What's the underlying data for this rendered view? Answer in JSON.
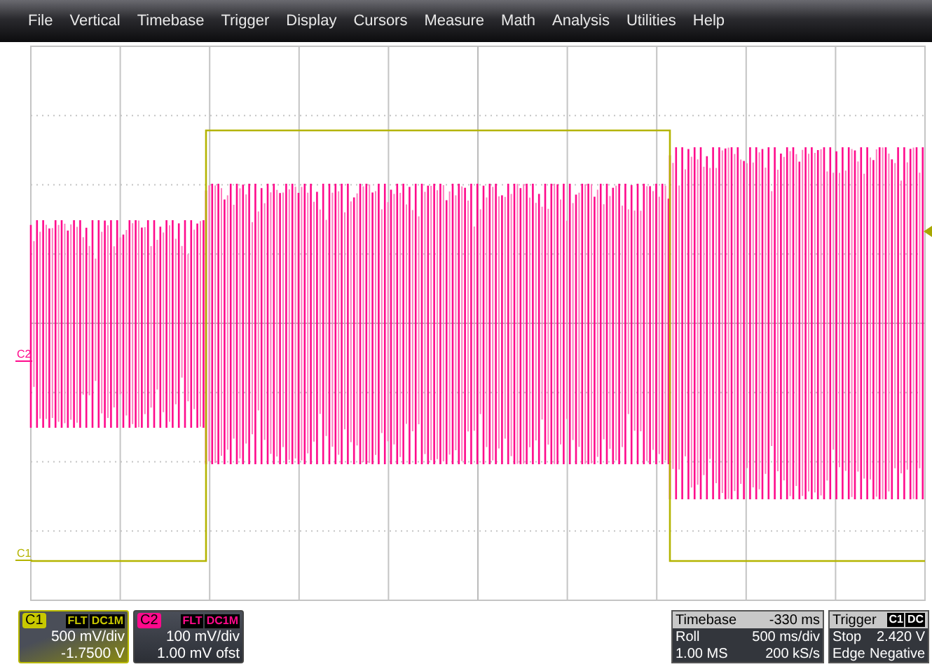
{
  "menu": [
    {
      "label": "File"
    },
    {
      "label": "Vertical"
    },
    {
      "label": "Timebase"
    },
    {
      "label": "Trigger"
    },
    {
      "label": "Display"
    },
    {
      "label": "Cursors"
    },
    {
      "label": "Measure"
    },
    {
      "label": "Math"
    },
    {
      "label": "Analysis"
    },
    {
      "label": "Utilities"
    },
    {
      "label": "Help"
    }
  ],
  "plot": {
    "channel_markers": [
      {
        "label": "C2",
        "color": "#ff0a8c"
      },
      {
        "label": "C1",
        "color": "#b4b400"
      }
    ]
  },
  "channels": [
    {
      "label": "C1",
      "color": "#c8c800",
      "selected": true,
      "badges": [
        "FLT",
        "DC1M"
      ],
      "scale": "500 mV/div",
      "offset": "-1.7500 V"
    },
    {
      "label": "C2",
      "color": "#ff0a8c",
      "selected": false,
      "badges": [
        "FLT",
        "DC1M"
      ],
      "scale": "100 mV/div",
      "offset": "1.00 mV ofst"
    }
  ],
  "timebase": {
    "title": "Timebase",
    "value": "-330 ms",
    "rows": [
      {
        "label": "Roll",
        "value": "500 ms/div"
      },
      {
        "label": "1.00 MS",
        "value": "200 kS/s"
      }
    ]
  },
  "trigger": {
    "title": "Trigger",
    "source": "C1",
    "coupling": "DC",
    "rows": [
      {
        "label": "Stop",
        "value": "2.420 V"
      },
      {
        "label": "Edge",
        "value": "Negative"
      }
    ]
  }
}
